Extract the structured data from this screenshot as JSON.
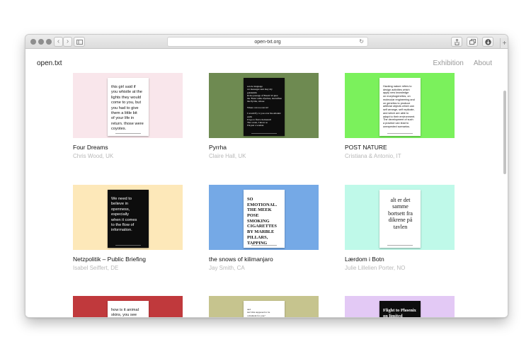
{
  "browser": {
    "url": "open-txt.org",
    "back_glyph": "‹",
    "forward_glyph": "›",
    "reload_glyph": "↻",
    "add_tab_glyph": "+"
  },
  "site": {
    "title": "open.txt",
    "nav": [
      "Exhibition",
      "About"
    ]
  },
  "cards": [
    {
      "title": "Four Dreams",
      "author": "Chris Wood, UK",
      "bg": "#f9e6eb",
      "poster": "white",
      "style": "",
      "text": "this girl said if\nyou whistle at the\nlights they would\ncome to you, but\nyou had to give\nthem a little bit\nof your life in\nreturn. those were\ncoyotes."
    },
    {
      "title": "Pyrrha",
      "author": "Claire Hall, UK",
      "bg": "#6e8a51",
      "poster": "black",
      "style": "serif-small",
      "text": "son de language\nwe messages sent may my goldsmith\n& the passage of Brazil: W-plex\nthe 'Fusis' while Pyrrhus, lanciaflate\nthe Pyrrha, whose\n\nWhere can we rest in?\n\nI would fly to you over the Atlantic earth\nI'd go to find a homestall\nThe ocean, I know so\nI'm just a woman"
    },
    {
      "title": "POST NATURE",
      "author": "Cristiana & Antonio, IT",
      "bg": "#7bf15c",
      "poster": "white",
      "style": "small",
      "text": "Hacking nature refers to\ndesign activities which\napply new knowledge\non morphogenetics, on\nmolecular engineering and\non genetics to produce\nartificial objects which can\nself arrange, self replicate,\nand which are able to\nadapt to their environment.\nThe development of such\na practice can lead to\nunexpected scenarios."
    },
    {
      "title": "Netzpolitik – Public Briefing",
      "author": "Isabel Seiffert, DE",
      "bg": "#fde8b9",
      "poster": "black",
      "style": "",
      "text": "We need to\nbelieve in\nopenness,\nespecially\nwhen it comes\nto the flow of\ninformation."
    },
    {
      "title": "the snows of kilimanjaro",
      "author": "Jay Smith, CA",
      "bg": "#75a9e6",
      "poster": "white",
      "style": "bold serif",
      "text": "SO\nEMOTIONAL.\nTHE MEEK\nPOSE\nSMOKING\nCIGARETTES\nBY MARBLE\nPILLARS,\nTAPPING"
    },
    {
      "title": "Lærdom i Botn",
      "author": "Julie Lillelien Porter, NO",
      "bg": "#bff9e9",
      "poster": "white",
      "style": "big",
      "text": "alt er det\nsamme\nbortsett fra\ndikrene på\ntavlen"
    },
    {
      "title": "",
      "author": "",
      "bg": "#c0393c",
      "poster": "white",
      "style": "",
      "text": "how is it animal\nskins, you see"
    },
    {
      "title": "",
      "author": "",
      "bg": "#c6c48e",
      "poster": "white",
      "style": "serif-small",
      "text": "and\nisn't this supposed to be\na moment for you?"
    },
    {
      "title": "",
      "author": "",
      "bg": "#e3c9f5",
      "poster": "black",
      "style": "bold serif",
      "text": "Flight to Phoenix\non limited"
    }
  ]
}
